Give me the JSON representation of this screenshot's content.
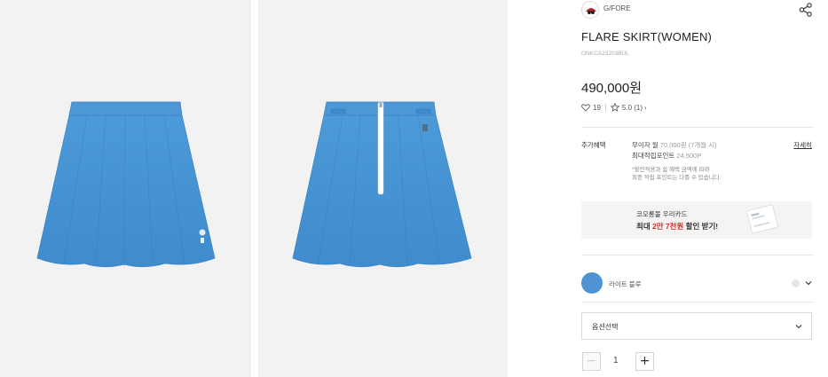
{
  "gallery": [
    {
      "view": "front",
      "background": "#f2f2f2",
      "skirt_color": "#4b97d6"
    },
    {
      "view": "back",
      "background": "#f2f2f2",
      "skirt_color": "#4b97d6"
    }
  ],
  "brand": {
    "name": "G/FORE"
  },
  "product": {
    "title": "FLARE SKIRT(WOMEN)",
    "sku": "GNKCA23203BUL",
    "price": "490,000원"
  },
  "stats": {
    "likes": "19",
    "rating": "5.0 (1)"
  },
  "benefits": {
    "label": "추가혜택",
    "installment_prefix": "무이자 월",
    "installment_amount": "70,000원 (7개월 시)",
    "points_label": "최대적립포인트",
    "points_value": "24,500P",
    "note_line1": "*할인적용과 쉼 혜택 금액에 따라",
    "note_line2": "최종 적립 포인트는 다를 수 있습니다.",
    "detail_link": "자세히"
  },
  "banner": {
    "line1": "코오롱몰 우리카드",
    "line2_prefix": "최대 ",
    "line2_highlight": "2만 7천원",
    "line2_suffix": " 할인 받기!"
  },
  "color_option": {
    "name": "라이트 블루",
    "swatch": "#4f93d4"
  },
  "option_select": {
    "placeholder": "옵션선택"
  },
  "quantity": {
    "value": "1",
    "minus": "−",
    "plus": "+"
  },
  "colors": {
    "accent_red": "#d2302a",
    "divider": "#e5e5e5",
    "price_text": "#222222"
  },
  "icons": {
    "share": "share-icon",
    "like": "heart-icon",
    "rating": "star-icon",
    "chevron": "chevron-down-icon"
  }
}
